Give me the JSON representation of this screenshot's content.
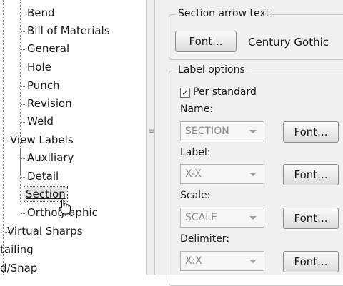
{
  "tree": {
    "items": [
      {
        "label": "Bend"
      },
      {
        "label": "Bill of Materials"
      },
      {
        "label": "General"
      },
      {
        "label": "Hole"
      },
      {
        "label": "Punch"
      },
      {
        "label": "Revision"
      },
      {
        "label": "Weld"
      },
      {
        "label": "View Labels"
      },
      {
        "label": "Auxiliary"
      },
      {
        "label": "Detail"
      },
      {
        "label": "Section"
      },
      {
        "label": "Orthographic"
      },
      {
        "label": "Virtual Sharps"
      },
      {
        "label": "tailing"
      },
      {
        "label": "d/Snap"
      }
    ]
  },
  "section_arrow": {
    "title": "Section arrow text",
    "font_button": "Font...",
    "font_name": "Century Gothic"
  },
  "label_options": {
    "title": "Label options",
    "per_standard": "Per standard",
    "name_label": "Name:",
    "name_value": "SECTION",
    "label_label": "Label:",
    "label_value": "X-X",
    "scale_label": "Scale:",
    "scale_value": "SCALE",
    "delimiter_label": "Delimiter:",
    "delimiter_value": "X:X",
    "font_button": "Font..."
  },
  "cursor_icon": "hand-pointer-icon"
}
